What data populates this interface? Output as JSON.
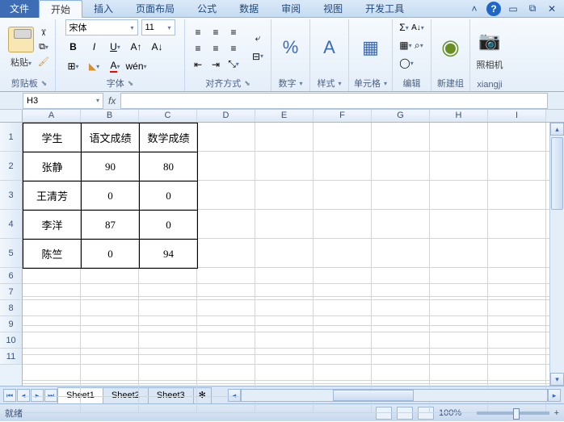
{
  "tabs": {
    "file": "文件",
    "home": "开始",
    "insert": "插入",
    "layout": "页面布局",
    "formula": "公式",
    "data": "数据",
    "review": "审阅",
    "view": "视图",
    "dev": "开发工具"
  },
  "groups": {
    "clipboard": "剪贴板",
    "font": "字体",
    "align": "对齐方式",
    "number": "数字",
    "style": "样式",
    "cells": "单元格",
    "editing": "编辑",
    "newgroup": "新建组",
    "camera": "照相机",
    "xiangji": "xiangji",
    "paste": "粘贴"
  },
  "font": {
    "name": "宋体",
    "size": "11"
  },
  "namebox": "H3",
  "cols": [
    "A",
    "B",
    "C",
    "D",
    "E",
    "F",
    "G",
    "H",
    "I"
  ],
  "rows": [
    "1",
    "2",
    "3",
    "4",
    "5",
    "6",
    "7",
    "8",
    "9",
    "10",
    "11"
  ],
  "table": {
    "headers": [
      "学生",
      "语文成绩",
      "数学成绩"
    ],
    "data": [
      [
        "张静",
        "90",
        "80"
      ],
      [
        "王清芳",
        "0",
        "0"
      ],
      [
        "李洋",
        "87",
        "0"
      ],
      [
        "陈竺",
        "0",
        "94"
      ]
    ]
  },
  "sheets": [
    "Sheet1",
    "Sheet2",
    "Sheet3"
  ],
  "status": {
    "ready": "就绪",
    "zoom": "100%"
  }
}
